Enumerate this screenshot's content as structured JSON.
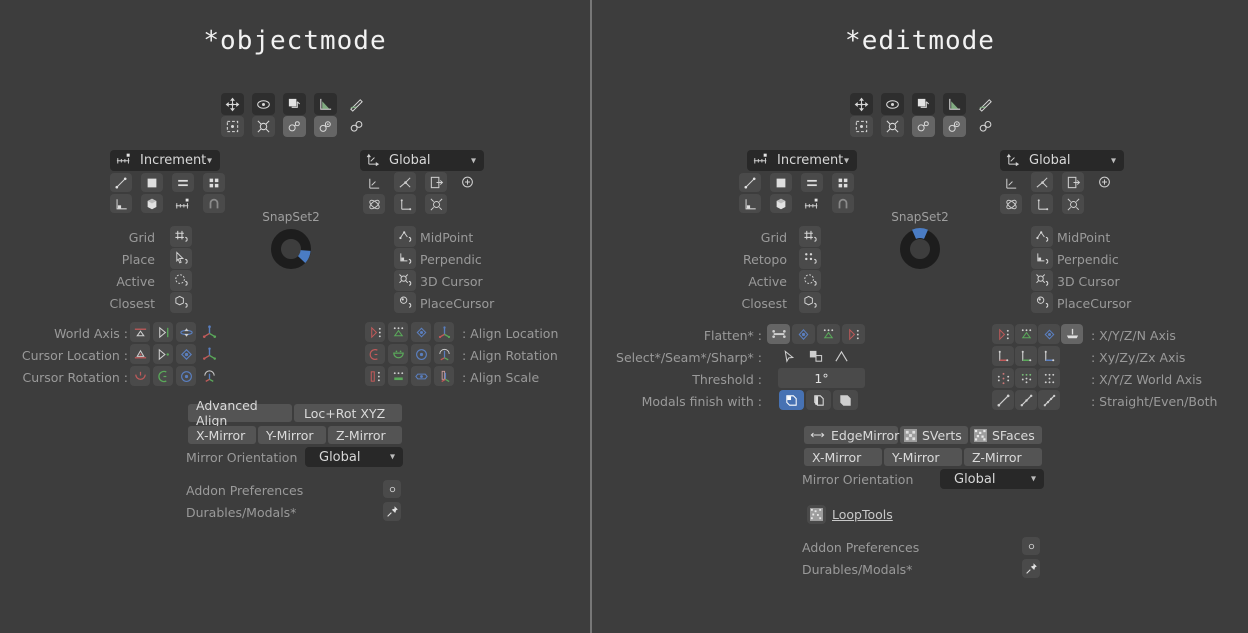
{
  "window": {
    "background_color": "#3d3d3d",
    "divider_color": "#777777",
    "accent_color": "#4772b3"
  },
  "panels": [
    {
      "id": "objectmode",
      "title": "*objectmode",
      "toolbar": {
        "row1": [
          "move-icon",
          "rotate-icon",
          "scale-icon",
          "measure-icon",
          "annotate-icon"
        ],
        "row2": [
          "select-box-icon",
          "cursor-icon",
          "snap-single-icon",
          "snap-double-icon",
          "snap-link-icon"
        ]
      },
      "snap_dropdown": {
        "icon": "increment-snap-icon",
        "value": "Increment"
      },
      "snap_modes": {
        "row1": [
          "edge-icon",
          "face-icon",
          "volume-icon",
          "grid-icon"
        ],
        "row2": [
          "vertex-icon",
          "cube-icon",
          "increment-icon",
          "magnet-icon"
        ]
      },
      "snap_targets": [
        {
          "label": "Grid",
          "icon": "grid-snap-icon"
        },
        {
          "label": "Place",
          "icon": "place-snap-icon"
        },
        {
          "label": "Active",
          "icon": "active-snap-icon"
        },
        {
          "label": "Closest",
          "icon": "closest-snap-icon"
        }
      ],
      "snapset": {
        "label": "SnapSet2",
        "segment_angle": 45
      },
      "orientation_dropdown": {
        "icon": "orientation-icon",
        "value": "Global"
      },
      "orientation_modes": {
        "row1": [
          "global-icon",
          "normal-icon",
          "gimbal-icon",
          "add-icon"
        ],
        "row2": [
          "view-icon",
          "local-icon",
          "cursor-orient-icon"
        ]
      },
      "orientation_targets": [
        {
          "label": "MidPoint",
          "icon": "midpoint-icon"
        },
        {
          "label": "Perpendic",
          "icon": "perpendicular-icon"
        },
        {
          "label": "3D Cursor",
          "icon": "3d-cursor-icon"
        },
        {
          "label": "PlaceCursor",
          "icon": "place-cursor-icon"
        }
      ],
      "transform_rows": [
        {
          "label": "World Axis :",
          "icons": [
            "axis-x-icon",
            "axis-y-icon",
            "axis-z-icon",
            "axis-xyz-icon"
          ]
        },
        {
          "label": "Cursor Location :",
          "icons": [
            "loc-x-icon",
            "loc-y-icon",
            "loc-z-icon",
            "loc-xyz-icon"
          ]
        },
        {
          "label": "Cursor Rotation :",
          "icons": [
            "rot-x-icon",
            "rot-y-icon",
            "rot-z-icon",
            "rot-xyz-icon"
          ]
        }
      ],
      "align_rows": [
        {
          "label": ": Align Location",
          "icons": [
            "al-x-icon",
            "al-y-icon",
            "al-z-icon",
            "al-xyz-icon"
          ]
        },
        {
          "label": ": Align Rotation",
          "icons": [
            "ar-x-icon",
            "ar-y-icon",
            "ar-z-icon",
            "ar-xyz-icon"
          ]
        },
        {
          "label": ": Align Scale",
          "icons": [
            "as-x-icon",
            "as-y-icon",
            "as-z-icon",
            "as-xyz-icon"
          ]
        }
      ],
      "align_buttons": {
        "advanced": "Advanced Align",
        "locrot": "Loc+Rot XYZ"
      },
      "mirror_buttons": [
        "X-Mirror",
        "Y-Mirror",
        "Z-Mirror"
      ],
      "mirror_orientation": {
        "label": "Mirror Orientation",
        "value": "Global"
      },
      "footer": [
        {
          "label": "Addon Preferences",
          "icon": "gear-icon"
        },
        {
          "label": "Durables/Modals*",
          "icon": "pin-icon"
        }
      ]
    },
    {
      "id": "editmode",
      "title": "*editmode",
      "toolbar": {
        "row1": [
          "move-icon",
          "rotate-icon",
          "scale-icon",
          "measure-icon",
          "annotate-icon"
        ],
        "row2": [
          "select-box-icon",
          "cursor-icon",
          "snap-single-icon",
          "snap-double-icon",
          "snap-link-icon"
        ]
      },
      "snap_dropdown": {
        "icon": "increment-snap-icon",
        "value": "Increment"
      },
      "snap_modes": {
        "row1": [
          "edge-icon",
          "face-icon",
          "volume-icon",
          "grid-icon"
        ],
        "row2": [
          "vertex-icon",
          "cube-icon",
          "increment-icon",
          "magnet-icon"
        ]
      },
      "snap_targets": [
        {
          "label": "Grid",
          "icon": "grid-snap-icon"
        },
        {
          "label": "Retopo",
          "icon": "retopo-snap-icon"
        },
        {
          "label": "Active",
          "icon": "active-snap-icon"
        },
        {
          "label": "Closest",
          "icon": "closest-snap-icon"
        }
      ],
      "snapset": {
        "label": "SnapSet2",
        "segment_angle": 270
      },
      "orientation_dropdown": {
        "icon": "orientation-icon",
        "value": "Global"
      },
      "orientation_modes": {
        "row1": [
          "global-icon",
          "normal-icon",
          "gimbal-icon",
          "add-icon"
        ],
        "row2": [
          "view-icon",
          "local-icon",
          "cursor-orient-icon"
        ]
      },
      "orientation_targets": [
        {
          "label": "MidPoint",
          "icon": "midpoint-icon"
        },
        {
          "label": "Perpendic",
          "icon": "perpendicular-icon"
        },
        {
          "label": "3D Cursor",
          "icon": "3d-cursor-icon"
        },
        {
          "label": "PlaceCursor",
          "icon": "place-cursor-icon"
        }
      ],
      "edit_rows": [
        {
          "label": "Flatten* :",
          "icons": [
            "flatten-icon",
            "flatten-center-icon",
            "flatten-tri-icon",
            "flatten-side-icon"
          ]
        },
        {
          "label": "Select*/Seam*/Sharp* :",
          "icons": [
            "select-pick-icon",
            "seam-icon",
            "sharp-icon"
          ]
        }
      ],
      "threshold": {
        "label": "Threshold :",
        "value": "1°"
      },
      "modals": {
        "label": "Modals finish with :",
        "icons": [
          "modal-a-icon",
          "modal-b-icon",
          "modal-c-icon"
        ],
        "active_index": 0
      },
      "axis_rows": [
        {
          "label": ": X/Y/Z/N Axis",
          "icons": [
            "ax-x-icon",
            "ax-y-icon",
            "ax-z-icon",
            "ax-n-icon"
          ]
        },
        {
          "label": ": Xy/Zy/Zx Axis",
          "icons": [
            "pl-xy-icon",
            "pl-zy-icon",
            "pl-zx-icon"
          ]
        },
        {
          "label": ": X/Y/Z World Axis",
          "icons": [
            "wx-icon",
            "wy-icon",
            "wz-icon"
          ]
        },
        {
          "label": ": Straight/Even/Both",
          "icons": [
            "straight-icon",
            "even-icon",
            "both-icon"
          ]
        }
      ],
      "edge_buttons": [
        {
          "label": "EdgeMirror",
          "icon": "arrows-lr-icon"
        },
        {
          "label": "SVerts",
          "icon": "sverts-icon"
        },
        {
          "label": "SFaces",
          "icon": "sfaces-icon"
        }
      ],
      "mirror_buttons": [
        "X-Mirror",
        "Y-Mirror",
        "Z-Mirror"
      ],
      "mirror_orientation": {
        "label": "Mirror Orientation",
        "value": "Global"
      },
      "looptools": {
        "label": "LoopTools",
        "icon": "looptools-icon"
      },
      "footer": [
        {
          "label": "Addon Preferences",
          "icon": "gear-icon"
        },
        {
          "label": "Durables/Modals*",
          "icon": "pin-icon"
        }
      ]
    }
  ]
}
